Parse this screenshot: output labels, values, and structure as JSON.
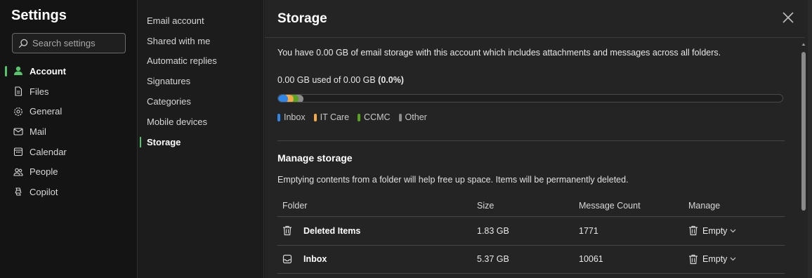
{
  "rail": {
    "title": "Settings",
    "search_placeholder": "Search settings",
    "items": [
      {
        "label": "Account",
        "icon": "person-icon"
      },
      {
        "label": "Files",
        "icon": "file-icon"
      },
      {
        "label": "General",
        "icon": "gear-icon"
      },
      {
        "label": "Mail",
        "icon": "mail-icon"
      },
      {
        "label": "Calendar",
        "icon": "calendar-icon"
      },
      {
        "label": "People",
        "icon": "people-icon"
      },
      {
        "label": "Copilot",
        "icon": "copilot-icon"
      }
    ]
  },
  "subnav": {
    "items": [
      {
        "label": "Email account"
      },
      {
        "label": "Shared with me"
      },
      {
        "label": "Automatic replies"
      },
      {
        "label": "Signatures"
      },
      {
        "label": "Categories"
      },
      {
        "label": "Mobile devices"
      },
      {
        "label": "Storage"
      }
    ]
  },
  "main": {
    "title": "Storage",
    "description": "You have 0.00 GB of email storage with this account which includes attachments and messages across all folders.",
    "usage_prefix": "0.00 GB used of 0.00 GB ",
    "usage_percent": "(0.0%)",
    "legend": [
      {
        "label": "Inbox",
        "color": "#2f86e6"
      },
      {
        "label": "IT Care",
        "color": "#f5a947"
      },
      {
        "label": "CCMC",
        "color": "#5aa31f"
      },
      {
        "label": "Other",
        "color": "#8c8c8c"
      }
    ],
    "manage_title": "Manage storage",
    "manage_description": "Emptying contents from a folder will help free up space. Items will be permanently deleted.",
    "table": {
      "headers": {
        "folder": "Folder",
        "size": "Size",
        "count": "Message Count",
        "manage": "Manage"
      },
      "rows": [
        {
          "icon": "trash-icon",
          "folder": "Deleted Items",
          "size": "1.83 GB",
          "count": "1771",
          "action": "Empty"
        },
        {
          "icon": "inbox-icon",
          "folder": "Inbox",
          "size": "5.37 GB",
          "count": "10061",
          "action": "Empty"
        }
      ]
    }
  },
  "colors": {
    "accent": "#59c26c"
  }
}
